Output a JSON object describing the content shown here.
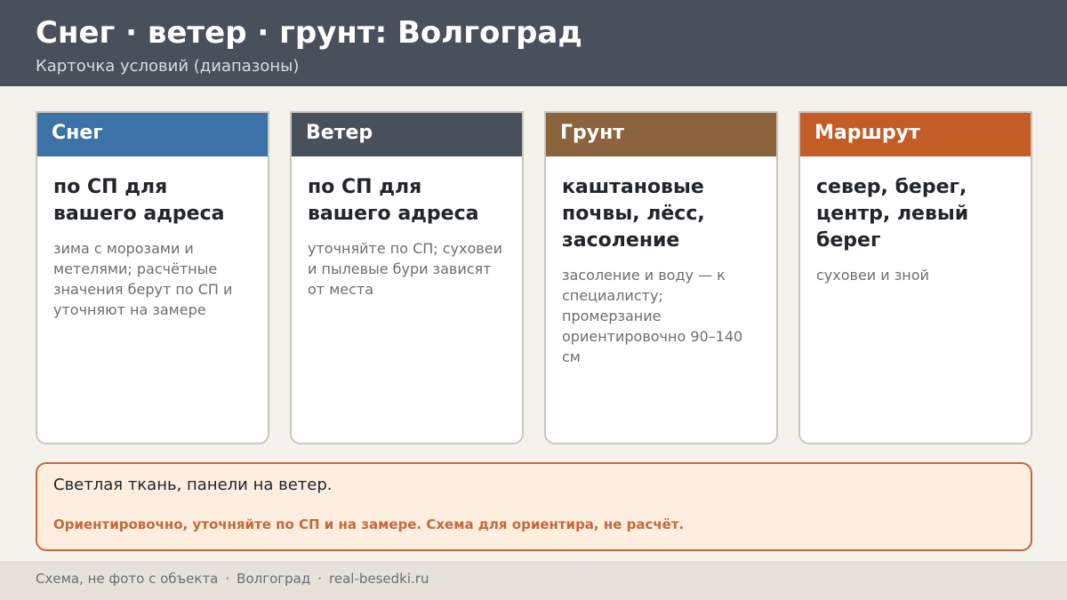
{
  "header": {
    "title": "Снег · ветер · грунт: Волгоград",
    "subtitle": "Карточка условий (диапазоны)"
  },
  "cards": [
    {
      "title": "Снег",
      "main": "по СП для вашего адреса",
      "note": "зима с морозами и метелями; расчётные значения берут по СП и уточняют на замере",
      "color": "#3b72a8"
    },
    {
      "title": "Ветер",
      "main": "по СП для вашего адреса",
      "note": "уточняйте по СП; суховеи и пылевые бури зависят от места",
      "color": "#48505c"
    },
    {
      "title": "Грунт",
      "main": "каштановые почвы, лёсс, засоление",
      "note": "засоление и воду — к специалисту; промерзание ориентировочно 90–140 см",
      "color": "#8b633d"
    },
    {
      "title": "Маршрут",
      "main": "север, берег, центр, левый берег",
      "note": "суховеи и зной",
      "color": "#c45c26"
    }
  ],
  "notice": {
    "text": "Светлая ткань, панели на ветер.",
    "warning": "Ориентировочно, уточняйте по СП и на замере. Схема для ориентира, не расчёт."
  },
  "footer": {
    "items": [
      "Схема, не фото с объекта",
      "Волгоград",
      "real-besedki.ru"
    ],
    "separator": "·"
  }
}
